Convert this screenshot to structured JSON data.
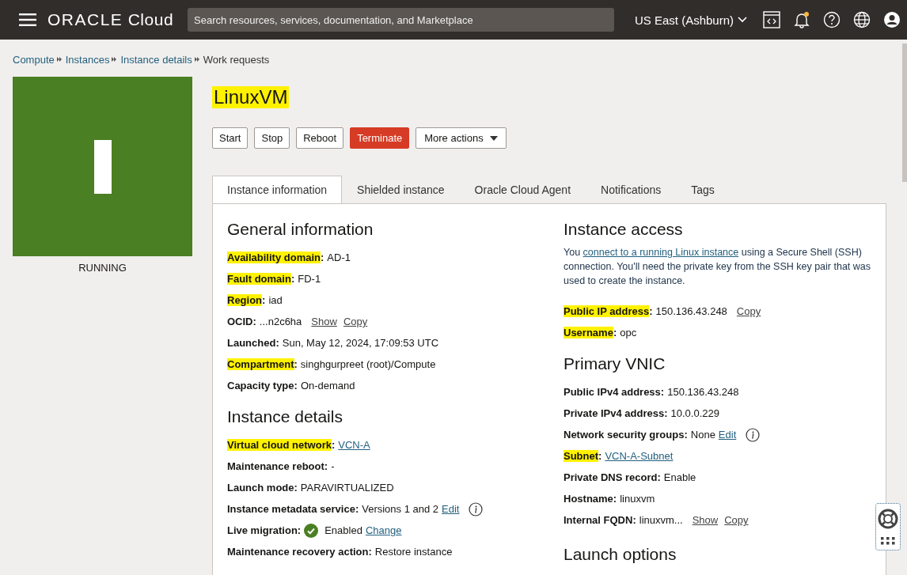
{
  "topbar": {
    "logo": "ORACLE",
    "logo_suffix": "Cloud",
    "search": {
      "placeholder": "Search resources, services, documentation, and Marketplace"
    },
    "region": "US East (Ashburn)"
  },
  "breadcrumbs": [
    {
      "label": "Compute",
      "kind": "link"
    },
    {
      "label": "Instances",
      "kind": "link"
    },
    {
      "label": "Instance details",
      "kind": "link"
    },
    {
      "label": "Work requests",
      "kind": "current"
    }
  ],
  "instance": {
    "name": "LinuxVM",
    "name_highlighted": true,
    "status": "RUNNING"
  },
  "actions": [
    {
      "label": "Start",
      "kind": "default"
    },
    {
      "label": "Stop",
      "kind": "default"
    },
    {
      "label": "Reboot",
      "kind": "default"
    },
    {
      "label": "Terminate",
      "kind": "danger"
    },
    {
      "label": "More actions",
      "kind": "menu"
    }
  ],
  "tabs": [
    {
      "label": "Instance information",
      "selected": true
    },
    {
      "label": "Shielded instance",
      "selected": false
    },
    {
      "label": "Oracle Cloud Agent",
      "selected": false
    },
    {
      "label": "Notifications",
      "selected": false
    },
    {
      "label": "Tags",
      "selected": false
    }
  ],
  "left_sections": [
    {
      "title": "General information",
      "fields": [
        {
          "label": "Availability domain",
          "highlighted": true,
          "parts": [
            {
              "kind": "text",
              "text": "AD-1"
            }
          ]
        },
        {
          "label": "Fault domain",
          "highlighted": true,
          "parts": [
            {
              "kind": "text",
              "text": "FD-1"
            }
          ]
        },
        {
          "label": "Region",
          "highlighted": true,
          "parts": [
            {
              "kind": "text",
              "text": "iad"
            }
          ]
        },
        {
          "label": "OCID",
          "highlighted": false,
          "parts": [
            {
              "kind": "text",
              "text": "...n2c6ha"
            },
            {
              "kind": "action",
              "text": "Show"
            },
            {
              "kind": "action",
              "text": "Copy"
            }
          ]
        },
        {
          "label": "Launched",
          "highlighted": false,
          "parts": [
            {
              "kind": "text",
              "text": "Sun, May 12, 2024, 17:09:53 UTC"
            }
          ]
        },
        {
          "label": "Compartment",
          "highlighted": true,
          "parts": [
            {
              "kind": "text",
              "text": "singhgurpreet (root)/Compute"
            }
          ]
        },
        {
          "label": "Capacity type",
          "highlighted": false,
          "parts": [
            {
              "kind": "text",
              "text": "On-demand"
            }
          ]
        }
      ]
    },
    {
      "title": "Instance details",
      "fields": [
        {
          "label": "Virtual cloud network",
          "highlighted": true,
          "parts": [
            {
              "kind": "link",
              "text": "VCN-A"
            }
          ]
        },
        {
          "label": "Maintenance reboot",
          "highlighted": false,
          "parts": [
            {
              "kind": "text",
              "text": "-"
            }
          ]
        },
        {
          "label": "Launch mode",
          "highlighted": false,
          "parts": [
            {
              "kind": "text",
              "text": "PARAVIRTUALIZED"
            }
          ]
        },
        {
          "label": "Instance metadata service",
          "highlighted": false,
          "parts": [
            {
              "kind": "text",
              "text": "Versions 1 and 2"
            },
            {
              "kind": "link",
              "text": "Edit"
            },
            {
              "kind": "info"
            }
          ]
        },
        {
          "label": "Live migration",
          "highlighted": false,
          "parts": [
            {
              "kind": "check"
            },
            {
              "kind": "text",
              "text": "Enabled"
            },
            {
              "kind": "link",
              "text": "Change"
            }
          ]
        },
        {
          "label": "Maintenance recovery action",
          "highlighted": false,
          "parts": [
            {
              "kind": "text",
              "text": "Restore instance"
            }
          ]
        }
      ]
    }
  ],
  "access": {
    "title": "Instance access",
    "description_before": "You",
    "description_link": "connect to a running Linux instance",
    "description_after": "using a Secure Shell (SSH) connection. You'll need the private key from the SSH key pair that was used to create the instance.",
    "fields": [
      {
        "label": "Public IP address",
        "highlighted": true,
        "parts": [
          {
            "kind": "text",
            "text": "150.136.43.248"
          },
          {
            "kind": "action",
            "text": "Copy"
          }
        ]
      },
      {
        "label": "Username",
        "highlighted": true,
        "parts": [
          {
            "kind": "text",
            "text": "opc"
          }
        ]
      }
    ]
  },
  "vnic": {
    "title": "Primary VNIC",
    "fields": [
      {
        "label": "Public IPv4 address",
        "highlighted": false,
        "parts": [
          {
            "kind": "text",
            "text": "150.136.43.248"
          }
        ]
      },
      {
        "label": "Private IPv4 address",
        "highlighted": false,
        "parts": [
          {
            "kind": "text",
            "text": "10.0.0.229"
          }
        ]
      },
      {
        "label": "Network security groups",
        "highlighted": false,
        "parts": [
          {
            "kind": "text",
            "text": "None"
          },
          {
            "kind": "link",
            "text": "Edit"
          },
          {
            "kind": "info"
          }
        ]
      },
      {
        "label": "Subnet",
        "highlighted": true,
        "parts": [
          {
            "kind": "link",
            "text": "VCN-A-Subnet"
          }
        ]
      },
      {
        "label": "Private DNS record",
        "highlighted": false,
        "parts": [
          {
            "kind": "text",
            "text": "Enable"
          }
        ]
      },
      {
        "label": "Hostname",
        "highlighted": false,
        "parts": [
          {
            "kind": "text",
            "text": "linuxvm"
          }
        ]
      },
      {
        "label": "Internal FQDN",
        "highlighted": false,
        "parts": [
          {
            "kind": "text",
            "text": "linuxvm..."
          },
          {
            "kind": "action",
            "text": "Show"
          },
          {
            "kind": "action",
            "text": "Copy"
          }
        ]
      }
    ]
  },
  "launch_title": "Launch options",
  "separator": ":"
}
